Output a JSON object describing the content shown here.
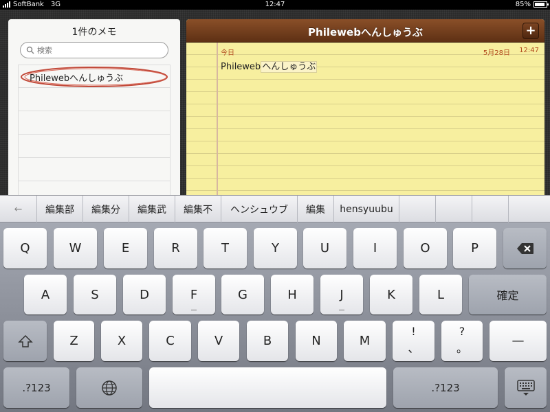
{
  "status": {
    "carrier": "SoftBank",
    "network": "3G",
    "time": "12:47",
    "battery": "85%",
    "battery_level": 0.85
  },
  "sidebar": {
    "title": "1件のメモ",
    "search_placeholder": "検索",
    "notes": [
      {
        "label": "Philewebへんしゅうぶ"
      }
    ]
  },
  "note": {
    "title": "Philewebへんしゅうぶ",
    "add": "+",
    "today": "今日",
    "date": "5月28日",
    "time": "12:47",
    "body_plain": "Phileweb",
    "body_marked": "へんしゅうぶ"
  },
  "candidates": [
    "←",
    "編集部",
    "編集分",
    "編集武",
    "編集不",
    "ヘンシュウブ",
    "編集",
    "hensyuubu",
    "",
    "",
    "",
    ""
  ],
  "keyboard": {
    "row1": [
      "Q",
      "W",
      "E",
      "R",
      "T",
      "Y",
      "U",
      "I",
      "O",
      "P"
    ],
    "row2": [
      "A",
      "S",
      "D",
      "F",
      "G",
      "H",
      "J",
      "K",
      "L"
    ],
    "row3": [
      "Z",
      "X",
      "C",
      "V",
      "B",
      "N",
      "M"
    ],
    "confirm": "確定",
    "excl_top": "!",
    "excl_bottom": "、",
    "q_top": "?",
    "q_bottom": "。",
    "dash": "—",
    "num_left": ".?123",
    "num_right": ".?123"
  },
  "colors": {
    "accent_red": "#b24a1e",
    "leather": "#6b3a1b",
    "paper": "#f7ef9f"
  }
}
